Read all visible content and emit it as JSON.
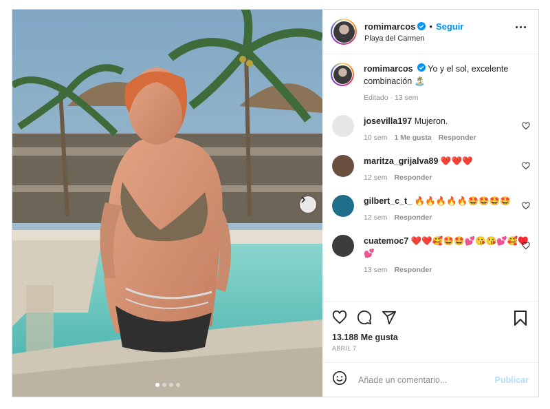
{
  "header": {
    "username": "romimarcos",
    "follow_label": "Seguir",
    "separator": "•",
    "location": "Playa del Carmen"
  },
  "caption": {
    "username": "romimarcos",
    "text": "Yo y el sol, excelente combinación 🏝️",
    "edited": "Editado · 13 sem"
  },
  "comments": [
    {
      "username": "josevilla197",
      "text": "Mujeron.",
      "time": "10 sem",
      "likes": "1 Me gusta",
      "reply": "Responder",
      "avatar_color": "#e6e6e6"
    },
    {
      "username": "maritza_grijalva89",
      "text": "❤️❤️❤️",
      "time": "12 sem",
      "likes": "",
      "reply": "Responder",
      "avatar_color": "#6b4f3f"
    },
    {
      "username": "gilbert_c_t_",
      "text": "🔥🔥🔥🔥🔥🤩🤩🤩🤩",
      "time": "12 sem",
      "likes": "",
      "reply": "Responder",
      "avatar_color": "#1f6f8b"
    },
    {
      "username": "cuatemoc7",
      "text": "❤️❤️🥰🤩🤩💕😘😘💕🥰♥️💕",
      "time": "13 sem",
      "likes": "",
      "reply": "Responder",
      "avatar_color": "#3c3c3c"
    }
  ],
  "stats": {
    "likes": "13.188 Me gusta",
    "date": "ABRIL 7"
  },
  "composer": {
    "placeholder": "Añade un comentario...",
    "publish_label": "Publicar"
  },
  "carousel": {
    "total": 4,
    "active": 1
  },
  "colors": {
    "accent": "#0095f6",
    "verified": "#0095f6",
    "text": "#262626",
    "muted": "#8e8e8e"
  }
}
